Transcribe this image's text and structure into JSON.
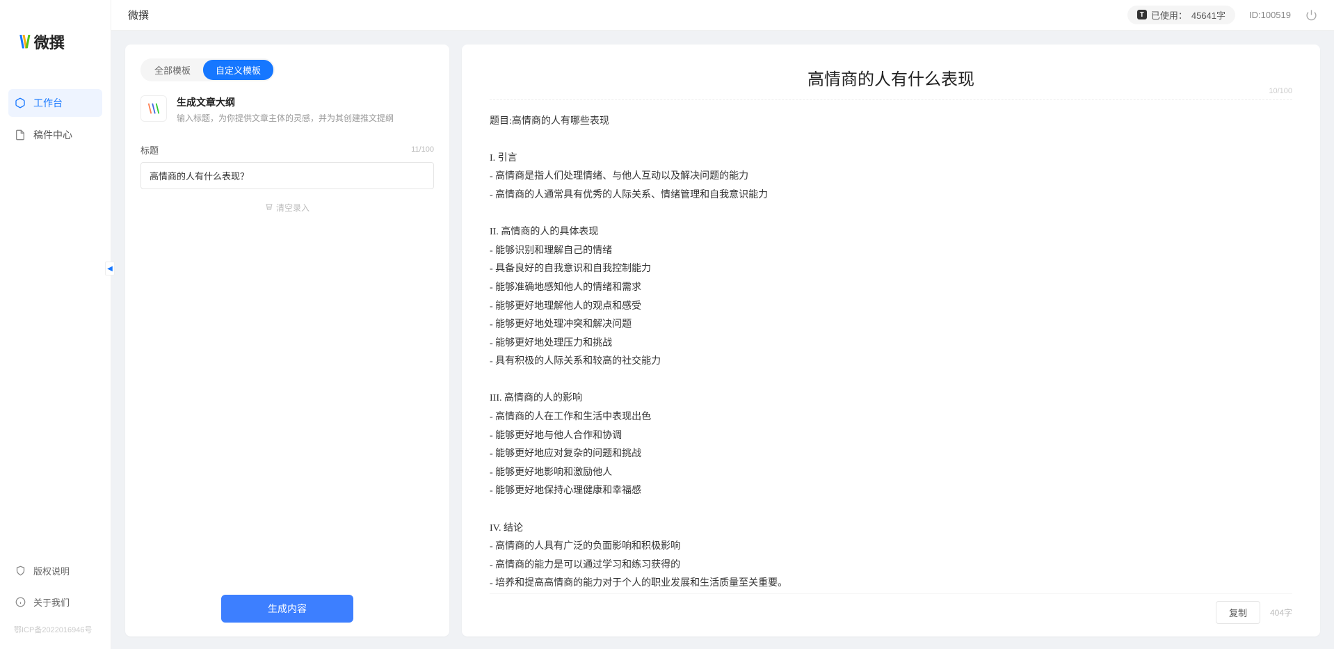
{
  "app": {
    "logo_text": "微撰",
    "title": "微撰"
  },
  "sidebar": {
    "nav": [
      {
        "label": "工作台",
        "icon": "cube-icon"
      },
      {
        "label": "稿件中心",
        "icon": "doc-icon"
      }
    ],
    "bottom": [
      {
        "label": "版权说明",
        "icon": "shield-icon"
      },
      {
        "label": "关于我们",
        "icon": "info-icon"
      }
    ],
    "icp": "鄂ICP备2022016946号"
  },
  "topbar": {
    "usage_prefix": "已使用：",
    "usage_value": "45641字",
    "id_label": "ID:100519"
  },
  "left": {
    "tabs": [
      "全部模板",
      "自定义模板"
    ],
    "template_title": "生成文章大纲",
    "template_sub": "输入标题，为你提供文章主体的灵感，并为其创建推文提纲",
    "field_label": "标题",
    "char_count": "11/100",
    "input_value": "高情商的人有什么表现？",
    "clear_label": "清空录入",
    "generate_label": "生成内容"
  },
  "right": {
    "title": "高情商的人有什么表现",
    "title_count": "10/100",
    "body": "题目:高情商的人有哪些表现\n\nI. 引言\n- 高情商是指人们处理情绪、与他人互动以及解决问题的能力\n- 高情商的人通常具有优秀的人际关系、情绪管理和自我意识能力\n\nII. 高情商的人的具体表现\n- 能够识别和理解自己的情绪\n- 具备良好的自我意识和自我控制能力\n- 能够准确地感知他人的情绪和需求\n- 能够更好地理解他人的观点和感受\n- 能够更好地处理冲突和解决问题\n- 能够更好地处理压力和挑战\n- 具有积极的人际关系和较高的社交能力\n\nIII. 高情商的人的影响\n- 高情商的人在工作和生活中表现出色\n- 能够更好地与他人合作和协调\n- 能够更好地应对复杂的问题和挑战\n- 能够更好地影响和激励他人\n- 能够更好地保持心理健康和幸福感\n\nIV. 结论\n- 高情商的人具有广泛的负面影响和积极影响\n- 高情商的能力是可以通过学习和练习获得的\n- 培养和提高高情商的能力对于个人的职业发展和生活质量至关重要。",
    "copy_label": "复制",
    "word_count": "404字"
  }
}
